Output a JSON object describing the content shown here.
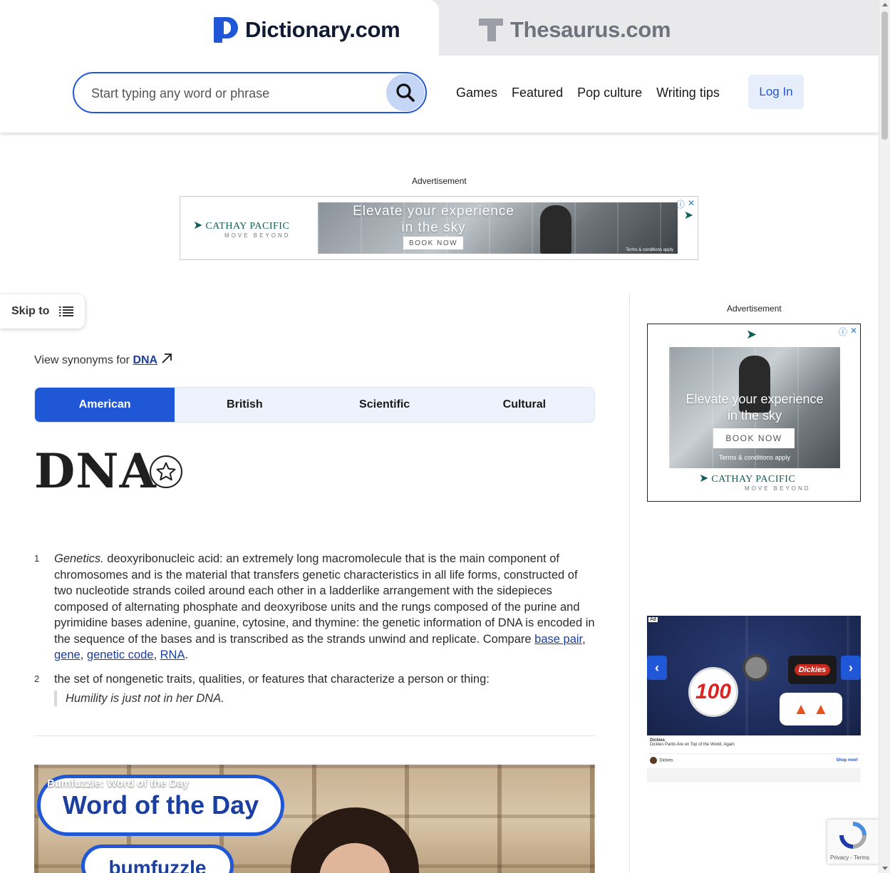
{
  "brands": {
    "dictionary": "Dictionary.com",
    "thesaurus": "Thesaurus.com"
  },
  "header": {
    "search_placeholder": "Start typing any word or phrase",
    "nav": [
      "Games",
      "Featured",
      "Pop culture",
      "Writing tips"
    ],
    "login": "Log In"
  },
  "ads": {
    "label": "Advertisement",
    "top": {
      "brand": "CATHAY PACIFIC",
      "tagline": "MOVE BEYOND",
      "headline_line1": "Elevate your experience",
      "headline_line2": "in the sky",
      "cta": "BOOK NOW",
      "terms": "Terms & conditions apply"
    },
    "right": {
      "headline_line1": "Elevate your experience",
      "headline_line2": "in the sky",
      "cta": "BOOK NOW",
      "terms": "Terms & conditions apply",
      "brand": "CATHAY PACIFIC",
      "tagline": "MOVE BEYOND"
    },
    "dickies": {
      "badge": "Ad",
      "patch_100": "100",
      "patch_brand": "Dickies",
      "advertiser": "Dickies",
      "description": "Dickies Pants Are on Top of the World. Again",
      "source": "Dickies",
      "cta": "Shop now!"
    }
  },
  "skip_to": "Skip to",
  "synonyms": {
    "prefix": "View synonyms for",
    "word": "DNA"
  },
  "tabs": [
    "American",
    "British",
    "Scientific",
    "Cultural"
  ],
  "active_tab": "American",
  "headword": "DNA",
  "definitions": [
    {
      "number": "1",
      "label": "Genetics.",
      "text": " deoxyribonucleic acid: an extremely long macromolecule that is the main component of chromosomes and is the material that transfers genetic characteristics in all life forms, constructed of two nucleotide strands coiled around each other in a ladderlike arrangement with the sidepieces composed of alternating phosphate and deoxyribose units and the rungs composed of the purine and pyrimidine bases adenine, guanine, cytosine, and thymine: the genetic information of DNA is encoded in the sequence of the bases and is transcribed as the strands unwind and replicate. Compare ",
      "links": [
        "base pair",
        "gene",
        "genetic code",
        "RNA"
      ]
    },
    {
      "number": "2",
      "text": "the set of nongenetic traits, qualities, or features that characterize a person or thing:",
      "example": "Humility is just not in her DNA."
    }
  ],
  "video": {
    "caption": "Bumfuzzle: Word of the Day",
    "banner": "Word of the Day",
    "word": "bumfuzzle"
  },
  "recaptcha": {
    "privacy": "Privacy",
    "terms": "Terms"
  }
}
